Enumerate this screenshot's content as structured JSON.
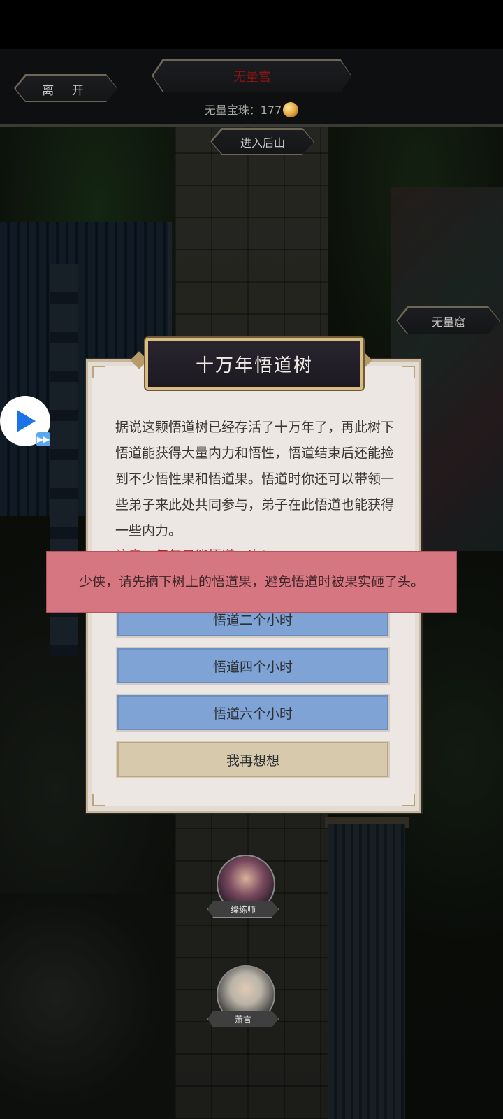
{
  "topbar": {
    "leave_label": "离 开",
    "location_title": "无量宫",
    "currency_label": "无量宝珠：177",
    "currency_icon": "pearl-icon"
  },
  "map": {
    "enter_mountain_label": "进入后山",
    "cave_label": "无量窟",
    "npcs": [
      {
        "name": "绛练师"
      },
      {
        "name": "萧言"
      }
    ]
  },
  "overlay": {
    "video_button_icon": "play-icon",
    "fast_forward_badge": "▶▶"
  },
  "dialog": {
    "title": "十万年悟道树",
    "description": "据说这颗悟道树已经存活了十万年了，再此树下悟道能获得大量内力和悟性，悟道结束后还能捡到不少悟性果和悟道果。悟道时你还可以带领一些弟子来此处共同参与，弟子在此悟道也能获得一些内力。",
    "warning": "注意：每年只能悟道一次!",
    "options": [
      "悟道二个小时",
      "悟道四个小时",
      "悟道六个小时"
    ],
    "cancel_label": "我再想想"
  },
  "toast": {
    "message": "少侠，请先摘下树上的悟道果，避免悟道时被果实砸了头。"
  },
  "colors": {
    "option_blue": "#7ea3d4",
    "cancel_tan": "#d7c9ac",
    "toast_pink": "#d57680",
    "title_red": "#8a1414"
  }
}
